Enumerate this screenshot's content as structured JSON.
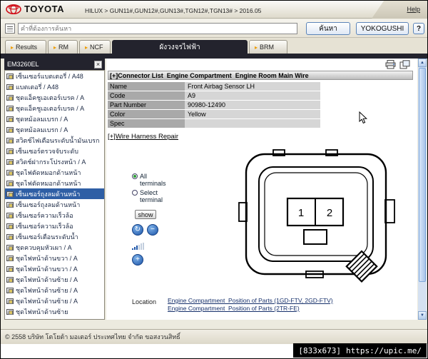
{
  "header": {
    "brand": "TOYOTA",
    "vehicle_path": "HILUX > GUN11#,GUN12#,GUN13#,TGN12#,TGN13# > 2016.05",
    "help_link": "Help"
  },
  "search": {
    "placeholder": "คำที่ต้องการค้นหา",
    "search_button": "ค้นหา",
    "yokogushi_button": "YOKOGUSHI",
    "question_button": "?"
  },
  "tabs": {
    "results": "Results",
    "rm": "RM",
    "ncf": "NCF",
    "active": "ผังวงจรไฟฟ้า",
    "brm": "BRM"
  },
  "sidebar": {
    "title": "EM3260EL",
    "items": [
      {
        "label": "เซ็นเซอร์แบตเตอรี่ / A48"
      },
      {
        "label": "แบตเตอรี่ / A48"
      },
      {
        "label": "ชุดแอ็คชูเอเตอร์เบรค / A"
      },
      {
        "label": "ชุดแอ็คชูเอเตอร์เบรค / A"
      },
      {
        "label": "ชุดหม้อลมเบรก / A"
      },
      {
        "label": "ชุดหม้อลมเบรก / A"
      },
      {
        "label": "สวิตช์ไฟเตือนระดับน้ำมันเบรก"
      },
      {
        "label": "เซ็นเซอร์ตรวจจับระดับ"
      },
      {
        "label": "สวิตช์ฝากระโปรงหน้า / A"
      },
      {
        "label": "ชุดไฟตัดหมอกด้านหน้า"
      },
      {
        "label": "ชุดไฟตัดหมอกด้านหน้า"
      },
      {
        "label": "เซ็นเซอร์ถุงลมด้านหน้า",
        "selected": true
      },
      {
        "label": "เซ็นเซอร์ถุงลมด้านหน้า"
      },
      {
        "label": "เซ็นเซอร์ความเร็วล้อ"
      },
      {
        "label": "เซ็นเซอร์ความเร็วล้อ"
      },
      {
        "label": "เซ็นเซอร์เตือนระดับน้ำ"
      },
      {
        "label": "ชุดควบคุมหัวเผา / A"
      },
      {
        "label": "ชุดไฟหน้าด้านขวา / A"
      },
      {
        "label": "ชุดไฟหน้าด้านขวา / A"
      },
      {
        "label": "ชุดไฟหน้าด้านซ้าย / A"
      },
      {
        "label": "ชุดไฟหน้าด้านซ้าย / A"
      },
      {
        "label": "ชุดไฟหน้าด้านซ้าย / A"
      },
      {
        "label": "ชุดไฟหน้าด้านซ้าย"
      }
    ]
  },
  "main": {
    "connector_header": "[+]Connector List  Engine Compartment  Engine Room Main Wire",
    "table": {
      "rows": [
        {
          "label": "Name",
          "value": "Front Airbag Sensor LH"
        },
        {
          "label": "Code",
          "value": "A9"
        },
        {
          "label": "Part Number",
          "value": "90980-12490"
        },
        {
          "label": "Color",
          "value": "Yellow"
        },
        {
          "label": "Spec",
          "value": ""
        }
      ]
    },
    "wire_harness_link": "[+]Wire Harness Repair",
    "terminal_options": {
      "all": "All terminals",
      "select": "Select terminal",
      "show_button": "show"
    },
    "diagram": {
      "terminal1": "1",
      "terminal2": "2"
    },
    "location": {
      "label": "Location",
      "links": [
        "Engine Compartment  Position of Parts (1GD-FTV, 2GD-FTV)",
        "Engine Compartment  Position of Parts (2TR-FE)"
      ]
    }
  },
  "statusbar": {
    "copyright": "© 2558 บริษัท โตโยต้า มอเตอร์ ประเทศไทย จำกัด ขอสงวนสิทธิ์"
  },
  "watermark": {
    "size": "[833x673]",
    "url": "https://upic.me/"
  },
  "icons": {
    "tab_arrow": "▸",
    "close": "×",
    "rotate": "↻",
    "zoom_out": "−",
    "zoom_in": "+",
    "scroll_up": "▲",
    "scroll_down": "▼"
  },
  "colors": {
    "toyota_red": "#d0111b",
    "tab_dark": "#23232d",
    "selected_blue": "#2f5fa5",
    "button_blue": "#1d55a8",
    "tab_arrow_orange": "#ef9c00"
  }
}
